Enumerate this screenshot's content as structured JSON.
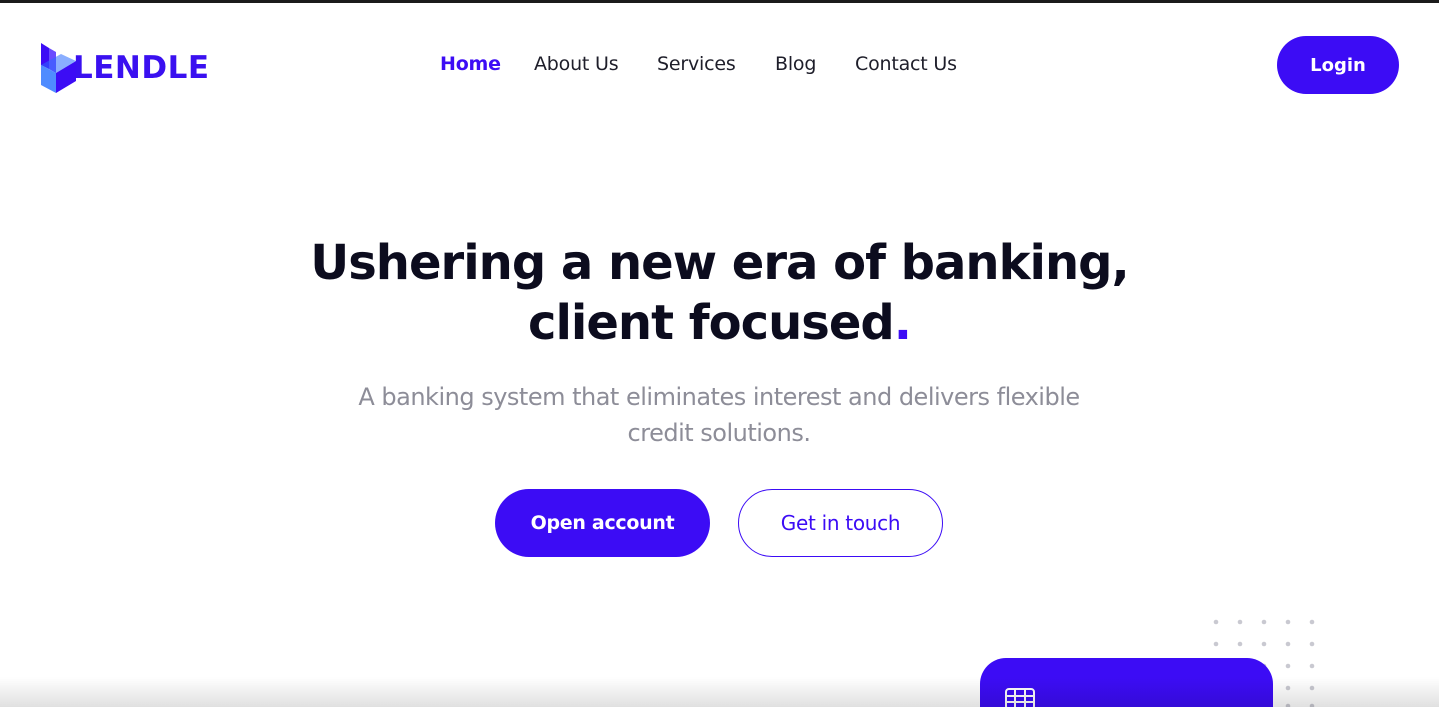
{
  "brand": {
    "name": "LENDLE",
    "color": "#3c0cf5"
  },
  "nav": {
    "items": [
      {
        "label": "Home",
        "active": true
      },
      {
        "label": "About Us",
        "active": false
      },
      {
        "label": "Services",
        "active": false
      },
      {
        "label": "Blog",
        "active": false
      },
      {
        "label": "Contact Us",
        "active": false
      }
    ],
    "login_label": "Login"
  },
  "hero": {
    "title_line1": "Ushering a new era of banking,",
    "title_line2": "client focused",
    "title_dot": ".",
    "subtitle": "A banking system that eliminates interest and delivers flexible credit solutions.",
    "primary_button": "Open account",
    "secondary_button": "Get in touch"
  },
  "decor": {
    "dot_pattern_icon": "dot-grid",
    "card_chip_icon": "chip-icon"
  }
}
